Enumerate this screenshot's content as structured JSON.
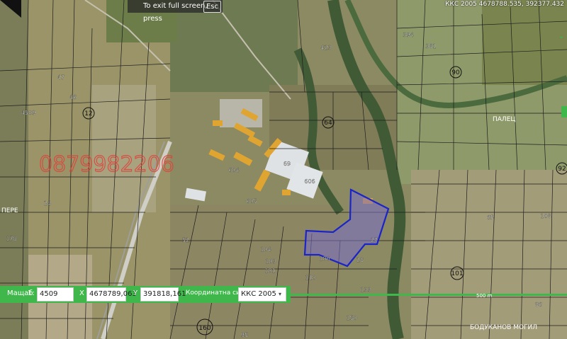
{
  "fullscreen": {
    "notice": "To exit full screen, press",
    "key": "Esc"
  },
  "top_coords": "ККС 2005 4678788.535, 392377.432",
  "toolbar": {
    "scale_label": "Мащаб",
    "scale_prefix": "1:",
    "scale_value": "4509",
    "x_label": "X",
    "x_value": "4678789,063",
    "y_label": "Y",
    "y_value": "391818,161",
    "coord_system_label": "Координатна система",
    "coord_system_value": "ККС 2005"
  },
  "scale_bar": "500 m",
  "watermark": "0879982206",
  "place_labels": {
    "pere": "ПЕРЕ",
    "palets": "ПАЛЕЦ",
    "bodyukanov": "БОДУКАНОВ МОГИЛ"
  },
  "circle_labels": {
    "c12": "12",
    "c64": "64",
    "c90": "90",
    "c101": "101",
    "c160": "160",
    "c92": "92"
  },
  "parcels": {
    "p4509": "4509",
    "p46": "46",
    "p69": "69",
    "p606": "606",
    "p604": "604",
    "p605": "605",
    "p104": "104",
    "p103": "103",
    "p106": "106",
    "p28": "28",
    "p27": "27",
    "p423": "423",
    "p394": "394",
    "p381": "381",
    "p150": "150",
    "p101": "101",
    "p95": "95",
    "p52": "52",
    "p47": "47",
    "p24": "24",
    "p178": "178",
    "p65": "65",
    "p108": "108",
    "p110": "110",
    "p133": "133",
    "p86": "86"
  },
  "colors": {
    "accent": "#3fb74a",
    "selection": "#1a24c8",
    "watermark": "#e0403a"
  }
}
